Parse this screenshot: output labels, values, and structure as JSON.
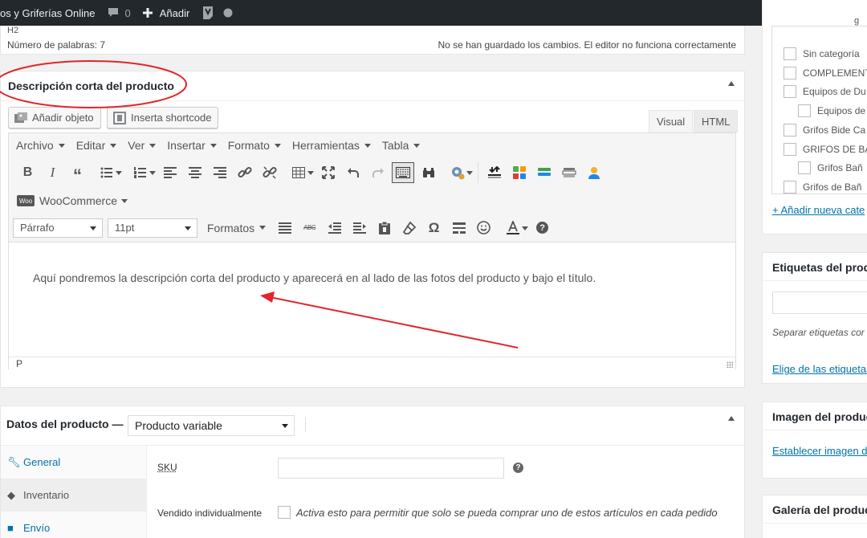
{
  "admin_bar": {
    "site_name": "os y Griferías Online",
    "comments_count": "0",
    "new_label": "Añadir"
  },
  "editor_status": {
    "h2_tag": "H2",
    "word_count": "Número de palabras: 7",
    "save_notice": "No se han guardado los cambios. El editor no funciona correctamente"
  },
  "short_description": {
    "title": "Descripción corta del producto",
    "add_media": "Añadir objeto",
    "insert_shortcode": "Inserta shortcode",
    "tab_visual": "Visual",
    "tab_html": "HTML",
    "menus": [
      "Archivo",
      "Editar",
      "Ver",
      "Insertar",
      "Formato",
      "Herramientas",
      "Tabla"
    ],
    "woocommerce": "WooCommerce",
    "block_format": "Párrafo",
    "font_size": "11pt",
    "formats": "Formatos",
    "content": "Aquí pondremos la descripción corta del producto y aparecerá en al lado de las fotos del producto y bajo el título.",
    "status_path": "P"
  },
  "product_data": {
    "title": "Datos del producto —",
    "product_type": "Producto variable",
    "tabs": [
      "General",
      "Inventario",
      "Envío"
    ],
    "sku_label": "SKU",
    "sold_individually_label": "Vendido individualmente",
    "sold_individually_desc": "Activa esto para permitir que solo se pueda comprar uno de estos artículos en cada pedido"
  },
  "categories": {
    "items": [
      "Sin categoría",
      "COMPLEMENT",
      "Equipos de Du",
      "Equipos de",
      "Grifos Bide Ca",
      "GRIFOS DE BA",
      "Grifos Bañ",
      "Grifos de Bañ"
    ],
    "add_new": "+ Añadir nueva cate",
    "top_cut": "g"
  },
  "tags": {
    "title": "Etiquetas del produ",
    "hint": "Separar etiquetas cor",
    "choose_link": "Elige de las etiquetas"
  },
  "product_image": {
    "title": "Imagen del product",
    "set_link": "Establecer imagen de"
  },
  "gallery": {
    "title": "Galería del product"
  },
  "colors": {
    "admin_bar": "#23282d",
    "link": "#0073aa",
    "annotation": "#e0262a"
  }
}
